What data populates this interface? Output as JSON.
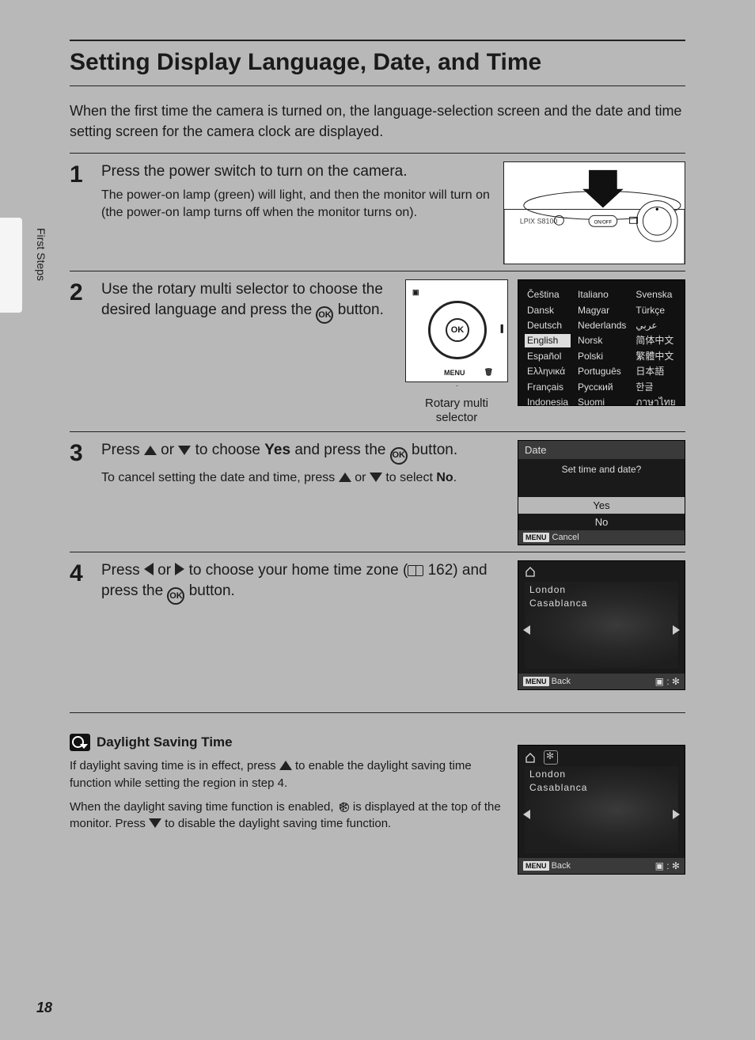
{
  "page_number": "18",
  "side_tab": "First Steps",
  "title": "Setting Display Language, Date, and Time",
  "intro": "When the first time the camera is turned on, the language-selection screen and the date and time setting screen for the camera clock are displayed.",
  "camera_model_label": "LPIX S8100",
  "onoff_label": "ON/OFF",
  "steps": {
    "s1": {
      "num": "1",
      "head": "Press the power switch to turn on the camera.",
      "sub": "The power-on lamp (green) will light, and then the monitor will turn on (the power-on lamp turns off when the monitor turns on)."
    },
    "s2": {
      "num": "2",
      "head_a": "Use the rotary multi selector to choose the desired language and press the ",
      "head_b": " button.",
      "rotary_ok": "OK",
      "rotary_menu": "MENU",
      "rotary_caption": "Rotary multi selector"
    },
    "s3": {
      "num": "3",
      "head_a": "Press ",
      "head_b": " or ",
      "head_c": " to choose ",
      "head_yes": "Yes",
      "head_d": " and press the ",
      "head_e": " button.",
      "sub_a": "To cancel setting the date and time, press ",
      "sub_b": " or ",
      "sub_c": " to select ",
      "sub_no": "No",
      "sub_d": "."
    },
    "s4": {
      "num": "4",
      "head_a": "Press ",
      "head_b": " or ",
      "head_c": " to choose your home time zone (",
      "head_ref": " 162) and press the ",
      "head_d": " button."
    }
  },
  "ok_label": "OK",
  "lang_screen": {
    "col1": [
      "Čeština",
      "Dansk",
      "Deutsch",
      "English",
      "Español",
      "Ελληνικά",
      "Français",
      "Indonesia"
    ],
    "col2": [
      "Italiano",
      "Magyar",
      "Nederlands",
      "Norsk",
      "Polski",
      "Português",
      "Русский",
      "Suomi"
    ],
    "col3": [
      "Svenska",
      "Türkçe",
      "عربي",
      "简体中文",
      "繁體中文",
      "日本語",
      "한글",
      "ภาษาไทย"
    ],
    "selected": "English"
  },
  "date_screen": {
    "title": "Date",
    "question": "Set time and date?",
    "yes": "Yes",
    "no": "No",
    "menu": "MENU",
    "cancel": "Cancel"
  },
  "tz_screen": {
    "loc1": "London",
    "loc2": "Casablanca",
    "menu": "MENU",
    "back": "Back"
  },
  "note": {
    "heading": "Daylight Saving Time",
    "p1_a": "If daylight saving time is in effect, press ",
    "p1_b": " to enable the daylight saving time function while setting the region in step 4.",
    "p2_a": "When the daylight saving time function is enabled, ",
    "p2_b": " is displayed at the top of the monitor. Press ",
    "p2_c": " to disable the daylight saving time function."
  }
}
